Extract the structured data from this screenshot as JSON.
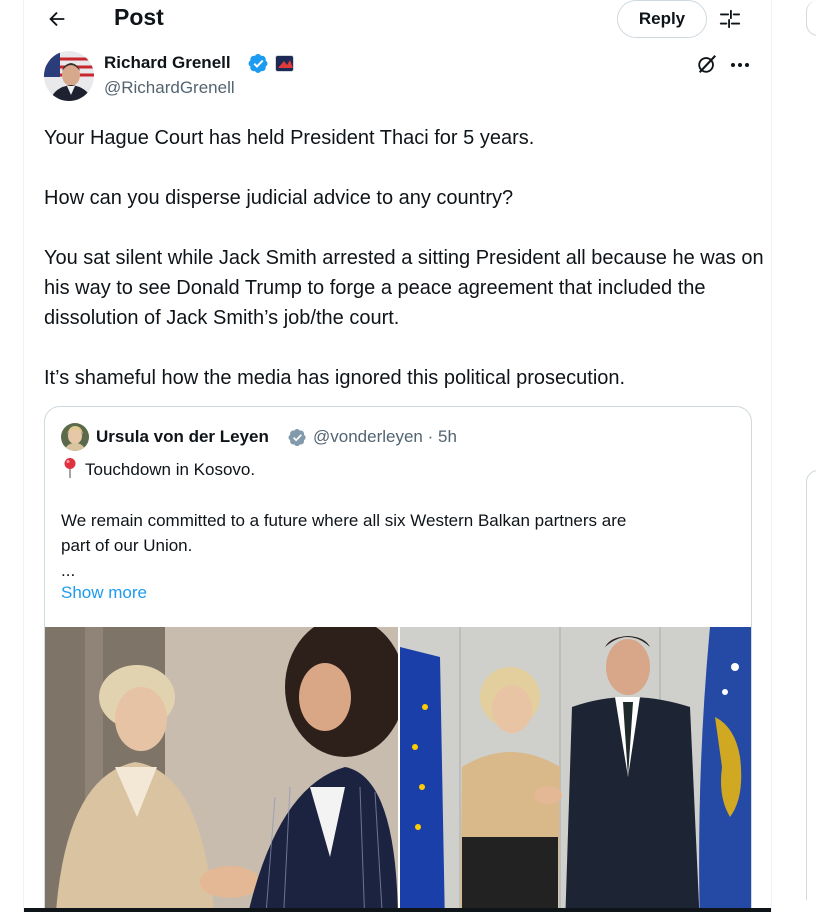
{
  "header": {
    "title": "Post",
    "reply_label": "Reply",
    "back_icon": "arrow-left-icon",
    "settings_icon": "sliders-icon"
  },
  "post": {
    "author": {
      "name": "Richard Grenell",
      "handle": "@RichardGrenell",
      "verified": true
    },
    "paragraphs": [
      "Your Hague Court has held President Thaci for 5 years.",
      "How can you disperse judicial advice to any country?",
      "You sat silent while Jack Smith arrested a sitting President all because he was on his way to see Donald Trump to forge  a peace agreement that included the dissolution of Jack Smith’s job/the court.",
      "It’s shameful how the media has ignored this political prosecution."
    ]
  },
  "quote": {
    "author": {
      "name": "Ursula von der Leyen",
      "handle": "@vonderleyen · 5h",
      "verified": true
    },
    "line1": "Touchdown in Kosovo.",
    "line2": "We remain committed to a future where all six Western Balkan partners are",
    "line3": "part of our Union.",
    "line4": "...",
    "show_more": "Show more"
  },
  "colors": {
    "text": "#0f1419",
    "secondary": "#536471",
    "accent": "#1d9bf0",
    "border": "#cfd9de"
  }
}
